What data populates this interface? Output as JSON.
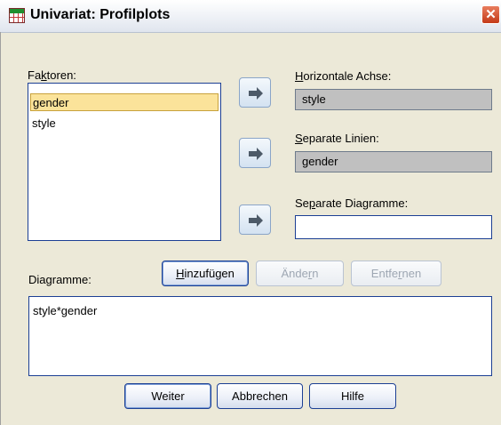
{
  "window": {
    "title": "Univariat: Profilplots",
    "close_icon": "close-icon"
  },
  "factors": {
    "label_pre": "Fa",
    "label_mnemonic": "k",
    "label_post": "toren:",
    "items": [
      "gender",
      "style"
    ],
    "selected": "gender"
  },
  "horizontal_axis": {
    "label_mnemonic": "H",
    "label_post": "orizontale Achse:",
    "value": "style"
  },
  "separate_lines": {
    "label_mnemonic": "S",
    "label_post": "eparate Linien:",
    "value": "gender"
  },
  "separate_charts": {
    "label_pre": "Se",
    "label_mnemonic": "p",
    "label_post": "arate Diagramme:",
    "value": ""
  },
  "plots": {
    "label_pre": "Dia",
    "label_mnemonic": "g",
    "label_post": "ramme:",
    "add_mnemonic": "H",
    "add_post": "inzufügen",
    "change_pre": "Ände",
    "change_mnemonic": "r",
    "change_post": "n",
    "remove_pre": "Entfe",
    "remove_mnemonic": "r",
    "remove_post": "nen",
    "items": [
      "style*gender"
    ]
  },
  "buttons": {
    "continue": "Weiter",
    "cancel": "Abbrechen",
    "help": "Hilfe"
  },
  "colors": {
    "selection": "#fbe39a",
    "border": "#1c3f94",
    "close": "#c43a18"
  }
}
